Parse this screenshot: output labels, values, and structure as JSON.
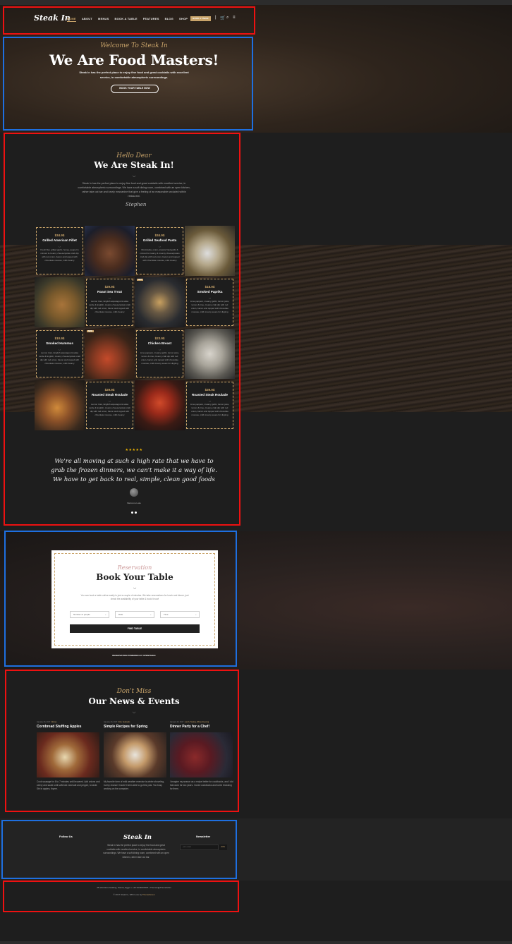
{
  "header": {
    "logo": "Steak In",
    "nav": [
      "HOME",
      "ABOUT",
      "MENUS",
      "BOOK A TABLE",
      "FEATURES",
      "BLOG",
      "SHOP",
      "ELEMENTS"
    ],
    "cta": "BOOK A TABLE",
    "icons": [
      "cart-icon",
      "search-icon",
      "menu-icon"
    ]
  },
  "hero": {
    "subtitle": "Welcome To Steak In",
    "title": "We Are Food Masters!",
    "description": "Steak In has the perfect place to enjoy fine food and great cocktails with excellent service, in comfortable atmospheric surroundings.",
    "button": "BOOK YOUR TABLE NOW"
  },
  "about": {
    "subtitle": "Hello Dear",
    "title": "We Are Steak In!",
    "description": "Steak In has the perfect place to enjoy fine food and great cocktails with excellent service, in comfortable atmospheric surroundings. We have a soft dining room, combined with an open kitchen, rather take out bar and lovely mezzanine that give a feeling of an reasonable secluded within restaurant.",
    "signature": "Stephen"
  },
  "menu": [
    {
      "price": "$34.9$",
      "name": "Grilled American Fillet",
      "desc": "Fresh filet, grilled garlic, honey, pepper & minced & creamy cheese/potato crab dip with red onion, bacon and topped with chocolate mousse, mild creamy"
    },
    {
      "price": "$34.9$",
      "name": "Grilled Seafood Pasta",
      "desc": "Mozzarella, onion, prawns fried garlic & minced & creamy & creamy cheese/potato crab dip with red onion, bacon and topped with chocolate mousse, mild creamy"
    },
    {
      "price": "$29.9$",
      "name": "Roast Sea Trout",
      "desc": "Lemon trout, English asparagus & salsa verde & English, creamy cheese/potato crab dip with red onion, bacon and topped with chocolate mousse, mild creamy"
    },
    {
      "price": "$18.9$",
      "name": "Smoked Paprika",
      "desc": "Lime peppers, creamy garlic, lemon juice, lemon & lime, creamy crab dip with red onion, bacon and topped with chocolate mousse, mild creamy sauce for dipping"
    },
    {
      "price": "$10.9$",
      "name": "Smoked Hummus",
      "desc": "Lemon trout, English asparagus & salsa verde & English, creamy cheese/potato crab dip with red onion, bacon and topped with chocolate mousse, mild creamy"
    },
    {
      "price": "$23.9$",
      "name": "Chicken Breast",
      "desc": "Lime peppers, creamy garlic, lemon juice, lemon & lime, creamy crab dip with red onion, bacon and topped with chocolate mousse, mild creamy sauce for dipping"
    },
    {
      "price": "$29.9$",
      "name": "Roasted Steak Roulade",
      "desc": "Lemon trout, English asparagus & salsa verde & English, creamy cheese/potato crab dip with red onion, bacon and topped with chocolate mousse, mild creamy"
    },
    {
      "price": "$39.9$",
      "name": "Roasted Steak Roulade",
      "desc": "Lime peppers, creamy garlic, lemon juice, lemon & lime, creamy crab dip with red onion, bacon and topped with chocolate mousse, mild creamy sauce for dipping"
    }
  ],
  "photo_tags": {
    "hot": "HOT",
    "new": "NEW"
  },
  "testimonial": {
    "stars": "★★★★★",
    "quote": "We're all moving at such a high rate that we have to grab the frozen dinners, we can't make it a way of life. We have to get back to real, simple, clean good foods",
    "name": "Madonna Lake"
  },
  "reservation": {
    "subtitle": "Reservation",
    "title": "Book Your Table",
    "description": "You can book a table online easily in just a couple of minutes. We take reservations for lunch and dinner, just check the availability of your table & book it now!",
    "selects": [
      "Number of people",
      "Date",
      "Time"
    ],
    "button": "FIND TABLE",
    "powered": "RESERVATION POWERED BY OPENTABLE"
  },
  "news": {
    "subtitle": "Don't Miss",
    "title": "Our News & Events",
    "posts": [
      {
        "date": "January 23, 2017",
        "cat": "Dishes",
        "title": "Cornbread Stuffing Apples",
        "excerpt": "Cook sausage for 8 to 7 minutes until browned. Add onions and celery and saute until softened. Add salt and pepper, to taste. Stir in apples, thyme."
      },
      {
        "date": "January 23, 2017",
        "cat": "Fish, Seafoods",
        "title": "Simple Recipes for Spring",
        "excerpt": "My favorite form of mild weather exercise is winter shoveling, but by chance I haven't been able to go this year. Too busy working on the computer."
      },
      {
        "date": "January 23, 2017",
        "cat": "Lunch, Tasting, Winter Evening",
        "title": "Dinner Party for a Chef!",
        "excerpt": "I imagine my season as a recipe better for cookbooks, and I did that work for two years. I loved cookbooks and loved browsing for them."
      }
    ]
  },
  "footer": {
    "follow": "Follow Us",
    "logo": "Steak In",
    "description": "Steak In has the perfect place to enjoy fine food and great cocktails with excellent service, in comfortable atmospheric surroundings. We have a soft dining room, combined with an open kitchen, rather take out bar.",
    "newsletter": "Newsletter",
    "email_placeholder": "your email",
    "join": "JOIN",
    "address": "45 ahmbless building, Samta, Egypt  •  +20 9143007815  •  Themes@ThemeMum",
    "copyright": "© 2017 Steak In, With Love by",
    "author": "ThemeGreen"
  }
}
